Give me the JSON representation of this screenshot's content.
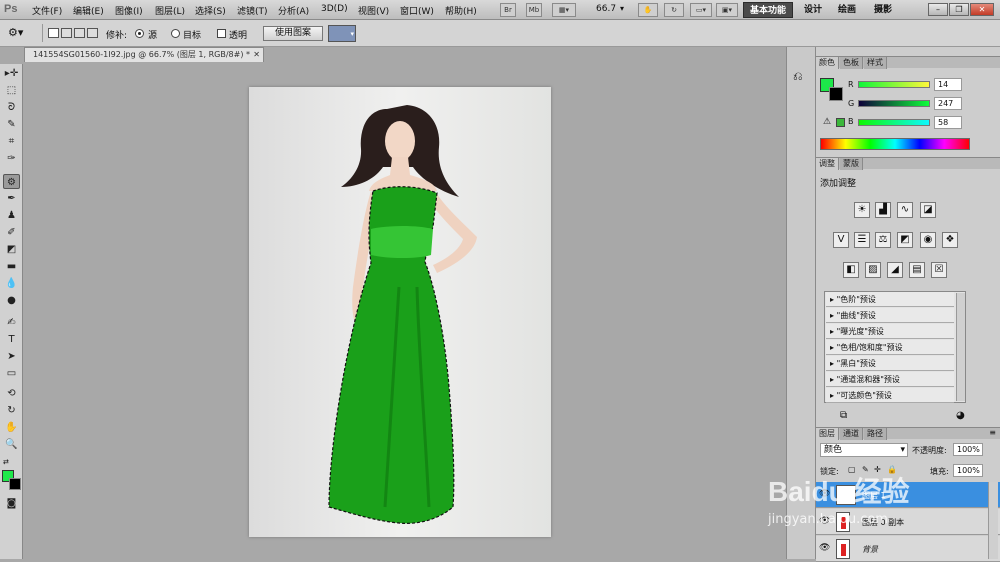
{
  "app": {
    "logo": "Ps"
  },
  "menu": [
    "文件(F)",
    "编辑(E)",
    "图像(I)",
    "图层(L)",
    "选择(S)",
    "滤镜(T)",
    "分析(A)",
    "3D(D)",
    "视图(V)",
    "窗口(W)",
    "帮助(H)"
  ],
  "menu_tools": {
    "br": "Br",
    "mb": "Mb",
    "zoom": "66.7"
  },
  "workspaces": {
    "active": "基本功能",
    "design": "设计",
    "paint": "绘画",
    "photo": "摄影"
  },
  "options": {
    "patch_label": "修补:",
    "source": "源",
    "target": "目标",
    "transparent": "透明",
    "use_pattern": "使用图案"
  },
  "document": {
    "tab_title": "141554SG01560-1I92.jpg @ 66.7% (图层 1, RGB/8#) *"
  },
  "colors": {
    "fg": "#1de84a",
    "bg": "#000000",
    "dress": "#1aa01a"
  },
  "color_panel": {
    "tabs": [
      "颜色",
      "色板",
      "样式"
    ],
    "r_label": "R",
    "g_label": "G",
    "b_label": "B",
    "r": "14",
    "g": "247",
    "b": "58"
  },
  "adjust_panel": {
    "tabs": [
      "调整",
      "蒙版"
    ],
    "title": "添加调整",
    "presets": [
      "\"色阶\"预设",
      "\"曲线\"预设",
      "\"曝光度\"预设",
      "\"色相/饱和度\"预设",
      "\"黑白\"预设",
      "\"通道混和器\"预设",
      "\"可选颜色\"预设"
    ]
  },
  "layers_panel": {
    "tabs": [
      "图层",
      "通道",
      "路径"
    ],
    "blend_mode": "颜色",
    "opacity_label": "不透明度:",
    "opacity": "100%",
    "lock_label": "锁定:",
    "fill_label": "填充:",
    "fill": "100%",
    "layers": [
      "图层 1",
      "图层 0 副本",
      "背景"
    ]
  },
  "watermark": {
    "brand": "Baidu 经验",
    "url": "jingyan.baidu.com"
  }
}
